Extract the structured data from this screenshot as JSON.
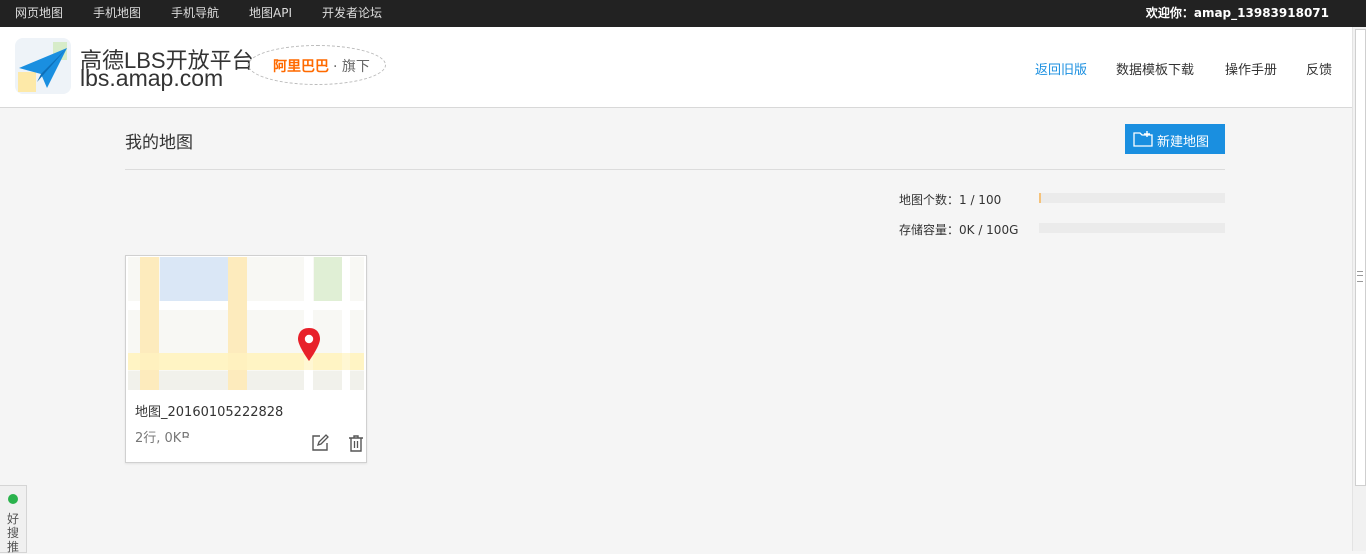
{
  "topbar": {
    "links": [
      "网页地图",
      "手机地图",
      "手机导航",
      "地图API",
      "开发者论坛"
    ],
    "welcome": "欢迎你：amap_13983918071"
  },
  "header": {
    "logo_title": "高德LBS开放平台",
    "logo_domain": "lbs.amap.com",
    "badge_brand": "阿里巴巴",
    "badge_suffix": "· 旗下",
    "nav": [
      "返回旧版",
      "数据模板下载",
      "操作手册",
      "反馈"
    ],
    "active_nav": "返回旧版"
  },
  "main": {
    "title": "我的地图",
    "new_button": "新建地图",
    "stats": {
      "count_label": "地图个数：1 / 100",
      "count_fraction": 0.01,
      "storage_label": "存储容量：0K / 100G",
      "storage_fraction": 0
    },
    "maps": [
      {
        "name": "地图_20160105222828",
        "meta": "2行, 0KB"
      }
    ]
  },
  "float_widget": {
    "text": "好搜推"
  },
  "colors": {
    "accent": "#1a8fe0",
    "brand_orange": "#ff6a00",
    "marker_red": "#e8212a",
    "topbar_bg": "#222222"
  },
  "icons": [
    "paper-plane-logo-icon",
    "folder-plus-icon",
    "edit-icon",
    "trash-icon",
    "map-pin-icon"
  ]
}
